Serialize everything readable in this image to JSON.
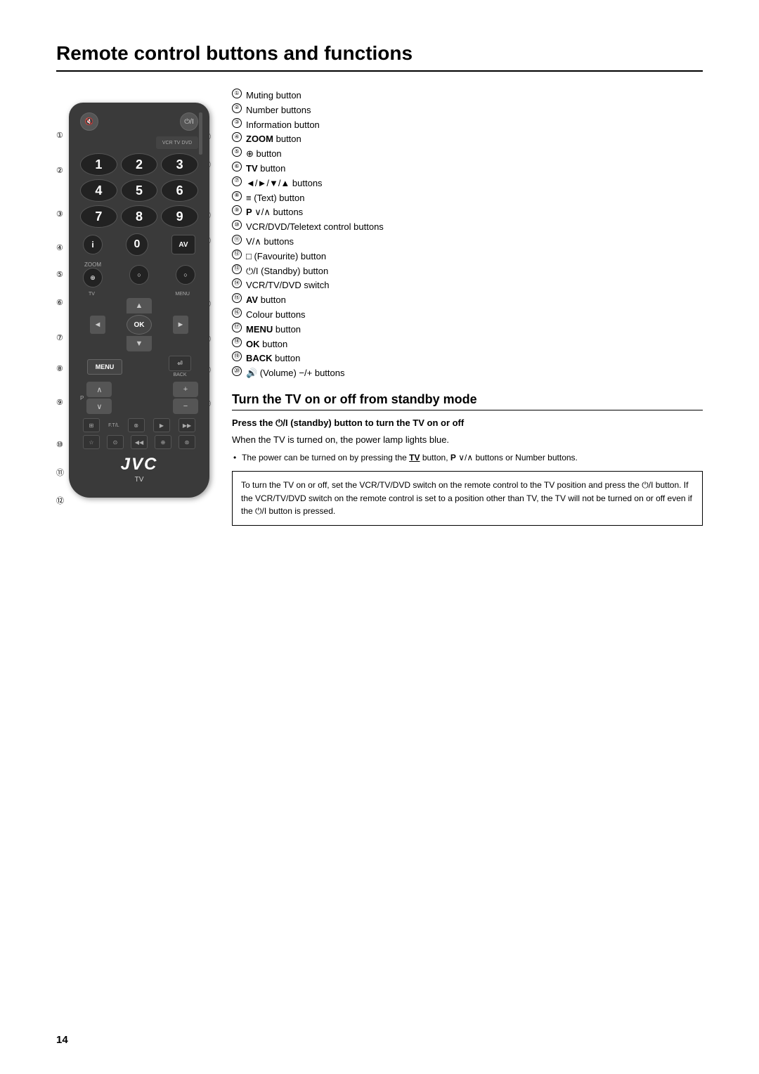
{
  "page": {
    "number": "14",
    "title": "Remote control buttons and functions"
  },
  "legend": {
    "items": [
      {
        "num": "①",
        "text": "Muting button"
      },
      {
        "num": "②",
        "text": "Number buttons"
      },
      {
        "num": "③",
        "text": "Information button"
      },
      {
        "num": "④",
        "text": "ZOOM button",
        "bold": "ZOOM"
      },
      {
        "num": "⑤",
        "text": "⊕ button"
      },
      {
        "num": "⑥",
        "text": "TV button",
        "bold": "TV"
      },
      {
        "num": "⑦",
        "text": "◄/►/▼/▲ buttons"
      },
      {
        "num": "⑧",
        "text": "≡ (Text) button"
      },
      {
        "num": "⑨",
        "text": "P ∨/∧ buttons"
      },
      {
        "num": "⑩",
        "text": "VCR/DVD/Teletext control buttons"
      },
      {
        "num": "⑪",
        "text": "V/∧ buttons"
      },
      {
        "num": "⑫",
        "text": "□ (Favourite) button"
      },
      {
        "num": "⑬",
        "text": "⏻/I (Standby) button"
      },
      {
        "num": "⑭",
        "text": "VCR/TV/DVD switch"
      },
      {
        "num": "⑮",
        "text": "AV button",
        "bold": "AV"
      },
      {
        "num": "⑯",
        "text": "Colour buttons"
      },
      {
        "num": "⑰",
        "text": "MENU button",
        "bold": "MENU"
      },
      {
        "num": "⑱",
        "text": "OK button",
        "bold": "OK"
      },
      {
        "num": "⑲",
        "text": "BACK button",
        "bold": "BACK"
      },
      {
        "num": "⑳",
        "text": "🔊 (Volume) −/+ buttons"
      }
    ]
  },
  "section2": {
    "title": "Turn the TV on or off from standby mode",
    "subsection": "Press the ⏻/I (standby) button to turn the TV on or off",
    "body": "When the TV is turned on, the power lamp lights blue.",
    "bullet": "The power can be turned on by pressing the TV button, P ∨/∧ buttons or Number buttons.",
    "notice": "To turn the TV on or off, set the VCR/TV/DVD switch on the remote control to the TV position and press the ⏻/I button. If the VCR/TV/DVD switch on the remote control is set to a position other than TV, the TV will not be turned on or off even if the ⏻/I button is pressed."
  },
  "remote": {
    "jvc_logo": "JVC",
    "tv_label": "TV"
  }
}
